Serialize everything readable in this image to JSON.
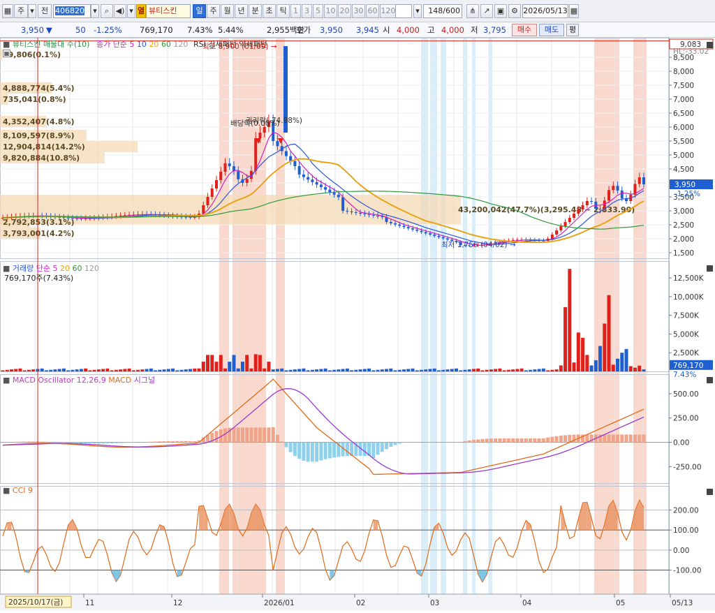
{
  "toolbar": {
    "menu_icon": "grid-icon",
    "market_type": "주",
    "all_label": "전",
    "stock_code": "406820",
    "stock_hot_tag": "열",
    "stock_name": "뷰티스킨",
    "period_buttons": [
      "일",
      "주",
      "월",
      "년",
      "분",
      "초",
      "틱"
    ],
    "selected_period": "일",
    "interval_buttons": [
      "1",
      "3",
      "5",
      "10",
      "20",
      "30",
      "60",
      "120"
    ],
    "count_value": "148",
    "count_total": "/600",
    "date_value": "2026/05/13"
  },
  "info": {
    "price": "3,950",
    "change": "50",
    "change_pct": "-1.25%",
    "volume": "769,170",
    "volume_ratio": "7.43%",
    "turnover": "5.44%",
    "amount": "2,955백만",
    "quote_label": "호가",
    "ask": "3,950",
    "bid": "3,945",
    "open_label": "시",
    "open": "4,000",
    "high_label": "고",
    "high": "4,000",
    "low_label": "저",
    "low": "3,795",
    "buy_label": "매수",
    "sell_label": "매도",
    "eval_label": "평"
  },
  "price_panel": {
    "legend_stock": "뷰티스킨",
    "legend_overlay": "매물대 수(10)",
    "legend_ma": "종가 단순",
    "ma_periods": [
      "5",
      "10",
      "20",
      "60",
      "120"
    ],
    "legend_rsi": "RSI 강세패턴",
    "legend_rsi2": "약세패턴",
    "top_price_label": "9,083",
    "last_price_label": "3,950",
    "last_change_label": "-1.25%",
    "high_annotation": "최고 8,900 (01/09)",
    "low_annotation": "최저 1,756 (04/02)",
    "dividend_annotation": "배당락(0.00%)",
    "rights_annotation": "권리락(-74.98%)",
    "corner_text": "HL:-33.02",
    "y_ticks": [
      "8,500",
      "8,000",
      "7,500",
      "7,000",
      "6,500",
      "6,000",
      "5,500",
      "5,000",
      "4,500",
      "4,000",
      "3,500",
      "3,000",
      "2,500",
      "2,000",
      "1,500"
    ],
    "volume_profile": [
      {
        "label": "49,806(0.1%)",
        "value": 49806
      },
      {
        "label": "4,888,774(5.4%)",
        "value": 4888774
      },
      {
        "label": "735,041(0.8%)",
        "value": 735041
      },
      {
        "label": "4,352,407(4.8%)",
        "value": 4352407
      },
      {
        "label": "8,109,597(8.9%)",
        "value": 8109597
      },
      {
        "label": "12,904,814(14.2%)",
        "value": 12904814
      },
      {
        "label": "9,820,884(10.8%)",
        "value": 9820884
      },
      {
        "label": "43,200,042(47.7%)(3,295.48 ~ 2,833.90)",
        "value": 43200042
      },
      {
        "label": "2,792,853(3.1%)",
        "value": 2792853
      },
      {
        "label": "3,793,001(4.2%)",
        "value": 3793001
      }
    ]
  },
  "volume_panel": {
    "legend": "거래량",
    "legend_ma": "단순",
    "ma_periods": [
      "5",
      "20",
      "60",
      "120"
    ],
    "value_text": "769,170주(7.43%)",
    "last_value": "769,170",
    "last_pct": "7.43%",
    "y_ticks": [
      "12,500K",
      "10,000K",
      "7,500K",
      "5,000K",
      "2,500K"
    ]
  },
  "macd_panel": {
    "legend_osc": "MACD Oscillator 12,26,9",
    "legend_macd": "MACD",
    "legend_signal": "시그널",
    "y_ticks": [
      "500.00",
      "250.00",
      "0.00",
      "-250.00"
    ]
  },
  "cci_panel": {
    "legend": "CCI 9",
    "y_ticks": [
      "200.00",
      "100.00",
      "0.00",
      "-100.00"
    ]
  },
  "x_axis": {
    "labels": [
      "11",
      "12",
      "2026/01",
      "02",
      "03",
      "04",
      "05",
      "05/13"
    ],
    "cursor_label": "2025/10/17(금)"
  },
  "colors": {
    "up": "#e0201b",
    "down": "#1f5fcf",
    "ma5": "#d21fbf",
    "ma10": "#2b56d8",
    "ma20": "#e8a415",
    "ma60": "#2e9a3a",
    "ma120": "#9a9a9a",
    "bull_band": "#f6c9b8",
    "bear_band": "#c9e7f6"
  }
}
